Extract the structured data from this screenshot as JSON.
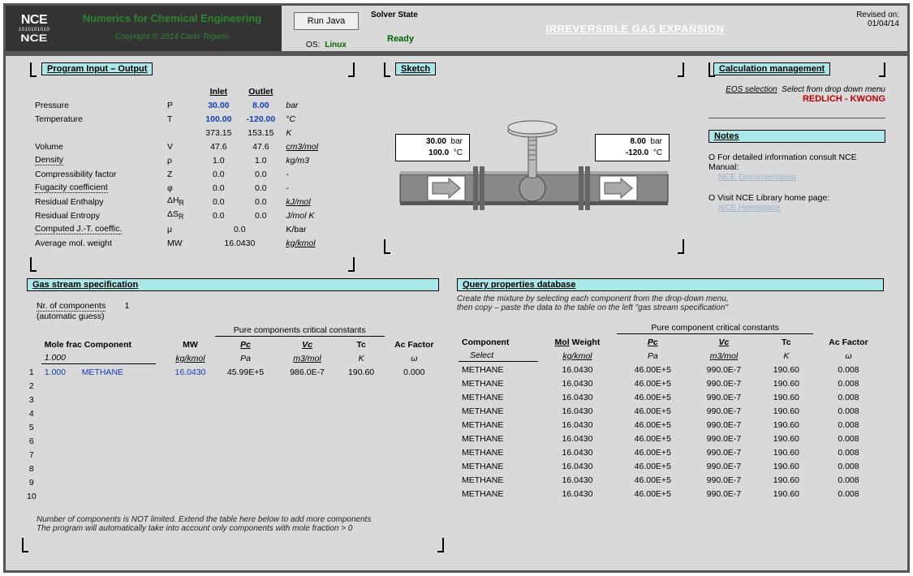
{
  "header": {
    "brand_title_pre": "N",
    "brand_title_mid1": "umerics for ",
    "brand_title_c": "C",
    "brand_title_mid2": "hemical ",
    "brand_title_e": "E",
    "brand_title_end": "ngineering",
    "copyright": "Copyright © 2014 Carlo Tegano",
    "run_btn": "Run Java",
    "os_lbl": "OS:",
    "os_val": "Linux",
    "solver_lbl": "Solver State",
    "solver_val": "Ready",
    "title": "IRREVERSIBLE GAS EXPANSION",
    "rev_lbl": "Revised on:",
    "rev_val": "01/04/14"
  },
  "io": {
    "hdr": "Program Input – Output",
    "col_inlet": "Inlet",
    "col_outlet": "Outlet",
    "rows": [
      {
        "name": "Pressure",
        "sym": "P",
        "in": "30.00",
        "out": "8.00",
        "unit": "bar",
        "blue": true
      },
      {
        "name": "Temperature",
        "sym": "T",
        "in": "100.00",
        "out": "-120.00",
        "unit": "°C",
        "blue": true
      },
      {
        "name": "",
        "sym": "",
        "in": "373.15",
        "out": "153.15",
        "unit": "K"
      },
      {
        "name": "Volume",
        "sym": "V",
        "in": "47.6",
        "out": "47.6",
        "unit": "cm3/mol",
        "hr": true,
        "uu": true
      },
      {
        "name": "Density",
        "sym": "ρ",
        "in": "1.0",
        "out": "1.0",
        "unit": "kg/m3",
        "ul": true
      },
      {
        "name": "Compressibility factor",
        "sym": "Z",
        "in": "0.0",
        "out": "0.0",
        "unit": "-",
        "hr": true
      },
      {
        "name": "Fugacity coefficient",
        "sym": "φ",
        "in": "0.0",
        "out": "0.0",
        "unit": "-",
        "ul": true
      },
      {
        "name": "Residual Enthalpy",
        "sym": "ΔH",
        "sub": "R",
        "in": "0.0",
        "out": "0.0",
        "unit": "kJ/mol",
        "uu": true
      },
      {
        "name": "Residual Entropy",
        "sym": "ΔS",
        "sub": "R",
        "in": "0.0",
        "out": "0.0",
        "unit": "J/mol K"
      }
    ],
    "jt_name": "Computed J.-T. coeffic.",
    "jt_sym": "μ",
    "jt_val": "0.0",
    "jt_unit": "K/bar",
    "mw_name": "Average mol. weight",
    "mw_sym": "MW",
    "mw_val": "16.0430",
    "mw_unit": "kg/kmol"
  },
  "sketch": {
    "hdr": "Sketch",
    "left_p": "30.00",
    "left_pu": "bar",
    "left_t": "100.0",
    "left_tu": "°C",
    "right_p": "8.00",
    "right_pu": "bar",
    "right_t": "-120.0",
    "right_tu": "°C"
  },
  "calc": {
    "hdr": "Calculation management",
    "eos_lbl": "EOS selection",
    "eos_hint": "Select from drop down menu",
    "eos_val": "REDLICH - KWONG",
    "notes_hdr": "Notes",
    "note1": "For detailed information consult NCE Manual:",
    "link1": "NCE Documentation",
    "note2": "Visit NCE Library home page:",
    "link2": "NCE Homepage"
  },
  "gas": {
    "hdr": "Gas stream specification",
    "nr_lbl": "Nr. of components",
    "nr_val": "1",
    "auto": "(automatic guess)",
    "group_hdr": "Pure components critical constants",
    "h_mf": "Mole frac",
    "h_comp": "Component",
    "h_mw": "MW",
    "h_pc": "Pc",
    "h_vc": "Vc",
    "h_tc": "Tc",
    "h_ac": "Ac Factor",
    "u_mf": "1.000",
    "u_mw": "kg/kmol",
    "u_pc": "Pa",
    "u_vc": "m3/mol",
    "u_tc": "K",
    "u_ac": "ω",
    "rows": [
      {
        "i": "1",
        "mf": "1.000",
        "name": "METHANE",
        "mw": "16.0430",
        "pc": "45.99E+5",
        "vc": "986.0E-7",
        "tc": "190.60",
        "ac": "0.000"
      },
      {
        "i": "2"
      },
      {
        "i": "3"
      },
      {
        "i": "4"
      },
      {
        "i": "5"
      },
      {
        "i": "6"
      },
      {
        "i": "7"
      },
      {
        "i": "8"
      },
      {
        "i": "9"
      },
      {
        "i": "10"
      }
    ],
    "hint1": "Number of components is NOT limited. Extend the table here below to add more components",
    "hint2": "The program will automatically take into account only components with mole fraction > 0"
  },
  "query": {
    "hdr": "Query properties database",
    "hint1": "Create the mixture by selecting each component from the drop-down menu,",
    "hint2": "then copy – paste the data to the table on the left \"gas stream specification\"",
    "group_hdr": "Pure component critical constants",
    "h_comp": "Component",
    "h_mw": "Mol Weight",
    "h_pc": "Pc",
    "h_vc": "Vc",
    "h_tc": "Tc",
    "h_ac": "Ac Factor",
    "sel": "Select",
    "u_mw": "kg/kmol",
    "u_pc": "Pa",
    "u_vc": "m3/mol",
    "u_tc": "K",
    "u_ac": "ω",
    "rows": [
      {
        "name": "METHANE",
        "mw": "16.0430",
        "pc": "46.00E+5",
        "vc": "990.0E-7",
        "tc": "190.60",
        "ac": "0.008"
      },
      {
        "name": "METHANE",
        "mw": "16.0430",
        "pc": "46.00E+5",
        "vc": "990.0E-7",
        "tc": "190.60",
        "ac": "0.008"
      },
      {
        "name": "METHANE",
        "mw": "16.0430",
        "pc": "46.00E+5",
        "vc": "990.0E-7",
        "tc": "190.60",
        "ac": "0.008"
      },
      {
        "name": "METHANE",
        "mw": "16.0430",
        "pc": "46.00E+5",
        "vc": "990.0E-7",
        "tc": "190.60",
        "ac": "0.008"
      },
      {
        "name": "METHANE",
        "mw": "16.0430",
        "pc": "46.00E+5",
        "vc": "990.0E-7",
        "tc": "190.60",
        "ac": "0.008"
      },
      {
        "name": "METHANE",
        "mw": "16.0430",
        "pc": "46.00E+5",
        "vc": "990.0E-7",
        "tc": "190.60",
        "ac": "0.008"
      },
      {
        "name": "METHANE",
        "mw": "16.0430",
        "pc": "46.00E+5",
        "vc": "990.0E-7",
        "tc": "190.60",
        "ac": "0.008"
      },
      {
        "name": "METHANE",
        "mw": "16.0430",
        "pc": "46.00E+5",
        "vc": "990.0E-7",
        "tc": "190.60",
        "ac": "0.008"
      },
      {
        "name": "METHANE",
        "mw": "16.0430",
        "pc": "46.00E+5",
        "vc": "990.0E-7",
        "tc": "190.60",
        "ac": "0.008"
      },
      {
        "name": "METHANE",
        "mw": "16.0430",
        "pc": "46.00E+5",
        "vc": "990.0E-7",
        "tc": "190.60",
        "ac": "0.008"
      }
    ]
  }
}
